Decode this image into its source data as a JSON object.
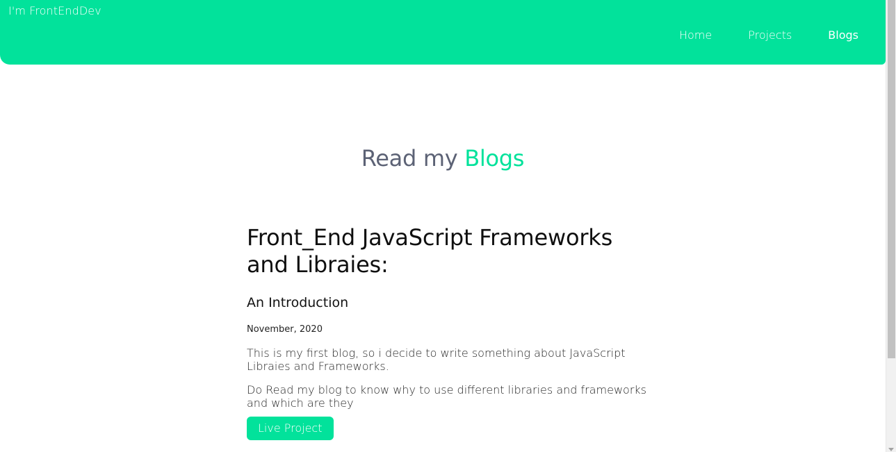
{
  "header": {
    "brand": "I'm FrontEndDev",
    "nav": [
      {
        "label": "Home"
      },
      {
        "label": "Projects"
      },
      {
        "label": "Blogs"
      }
    ]
  },
  "main": {
    "title_prefix": "Read my",
    "title_accent": "Blogs",
    "blog": {
      "title": "Front_End JavaScript Frameworks and Libraies:",
      "subtitle": "An Introduction",
      "date": "November, 2020",
      "paragraphs": [
        "This is my first blog, so i decide to write something about JavaScript Libraies and Frameworks.",
        "Do Read my blog to know why to use different libraries and frameworks and which are they"
      ],
      "button_label": "Live Project"
    }
  },
  "colors": {
    "accent": "#02e29b",
    "title_gray": "#5c6275"
  }
}
